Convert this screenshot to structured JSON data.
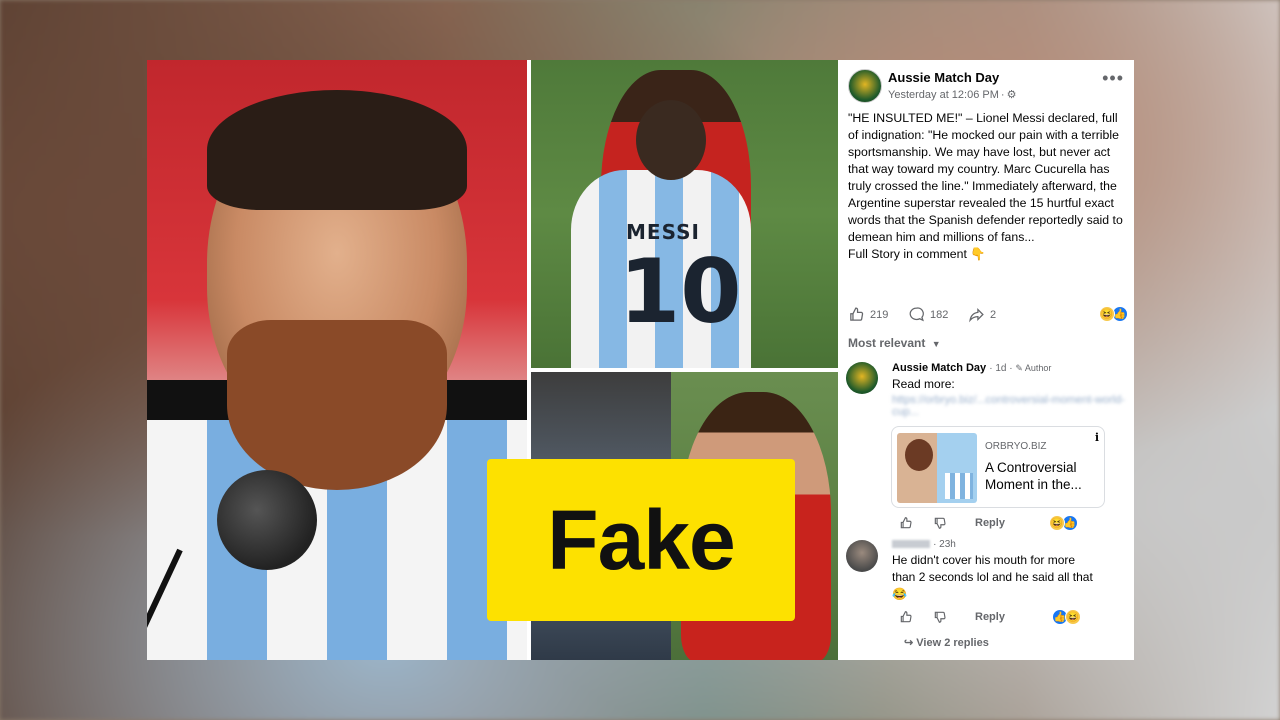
{
  "badge": {
    "label": "Fake",
    "color": "#fde100"
  },
  "post": {
    "page_name": "Aussie Match Day",
    "timestamp": "Yesterday at 12:06 PM",
    "body": [
      "\"HE INSULTED ME!\" – Lionel Messi declared, full of indignation: \"He mocked our pain with a terrible sportsmanship. We may have lost, but never act that way toward my country. Marc Cucurella has truly crossed the line.\" Immediately afterward, the Argentine superstar revealed the 15 hurtful exact words that the Spanish defender reportedly said to demean him and millions of fans...",
      "Full Story in comment 👇"
    ],
    "likes": "219",
    "comments": "182",
    "shares": "2",
    "sort_label": "Most relevant",
    "photo_text": {
      "jersey_name": "MESSI",
      "jersey_number": "10"
    }
  },
  "comments": [
    {
      "author": "Aussie Match Day",
      "age": "1d",
      "badge": "Author",
      "text": "Read more:",
      "link_text": "https://orbryo.biz/...controversial-moment-world-cup...",
      "card": {
        "domain": "ORBRYO.BIZ",
        "title": "A Controversial Moment in the..."
      },
      "reply_label": "Reply"
    },
    {
      "author": "",
      "age": "23h",
      "text": "He didn't cover his mouth for more than 2 seconds lol and he said all that 😂",
      "reply_label": "Reply",
      "view_replies": "View 2 replies"
    }
  ],
  "colors": {
    "accent": "#1877f2",
    "muted": "#65676b"
  }
}
